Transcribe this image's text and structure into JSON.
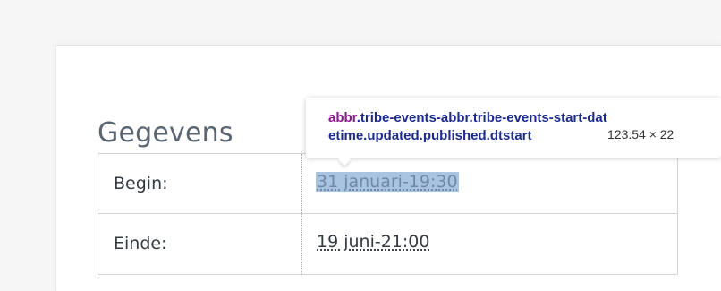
{
  "section": {
    "heading": "Gegevens"
  },
  "details": {
    "rows": [
      {
        "label": "Begin:",
        "value": "31 januari-19:30"
      },
      {
        "label": "Einde:",
        "value": "19 juni-21:00"
      }
    ]
  },
  "inspector_tooltip": {
    "tag": "abbr",
    "selector": ".tribe-events-abbr.tribe-events-start-datetime.updated.published.dtstart",
    "dimensions": "123.54 × 22"
  },
  "colors": {
    "selection_highlight": "#a9c4e0",
    "selector_class": "#1c2b8c",
    "selector_tag": "#8b1a8c"
  }
}
